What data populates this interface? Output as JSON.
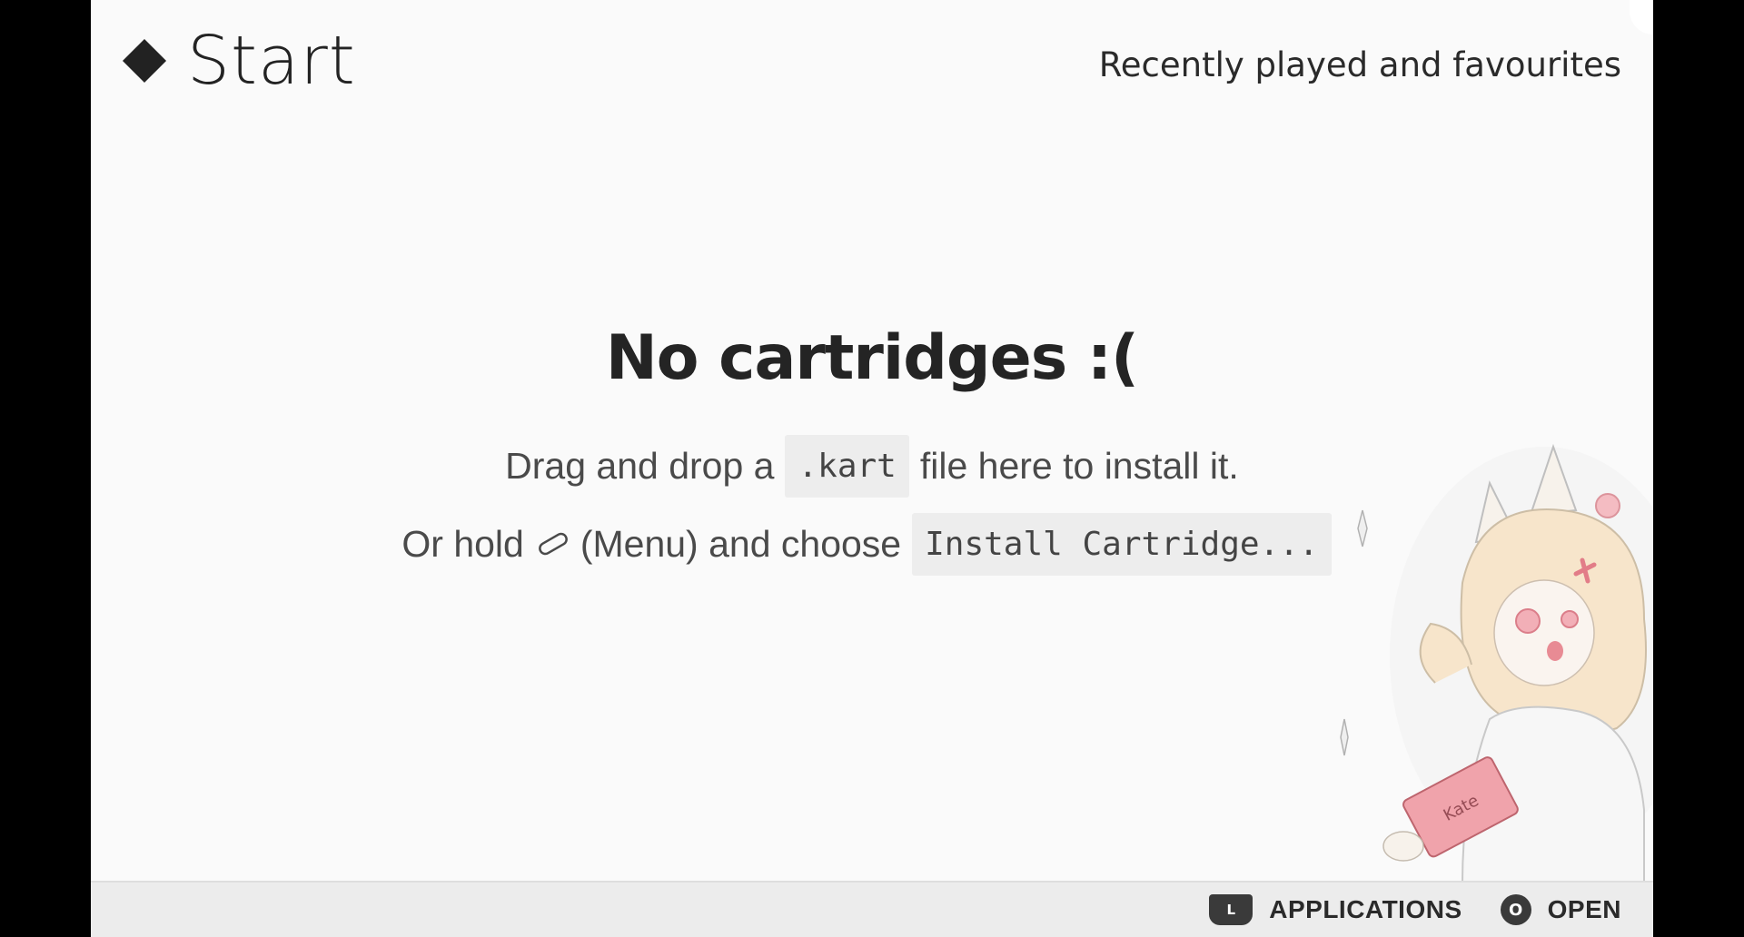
{
  "header": {
    "title": "Start",
    "subtitle": "Recently played and favourites"
  },
  "empty_state": {
    "title": "No cartridges :(",
    "line1": {
      "before": "Drag and drop a",
      "code": ".kart",
      "after": "file here to install it."
    },
    "line2": {
      "before": "Or hold",
      "icon": "menu-pill-icon",
      "middle": "(Menu) and choose",
      "code": "Install Cartridge..."
    }
  },
  "footer": {
    "applications": {
      "key": "L",
      "label": "APPLICATIONS"
    },
    "open": {
      "key": "O",
      "label": "OPEN"
    }
  },
  "illustration": {
    "book_label": "Kate",
    "icon": "fox-girl-illustration"
  },
  "colors": {
    "background": "#fafafa",
    "footer_bg": "#ececec",
    "text_dark": "#242424",
    "code_bg": "#ededed",
    "accent_pink": "#e58a93"
  }
}
